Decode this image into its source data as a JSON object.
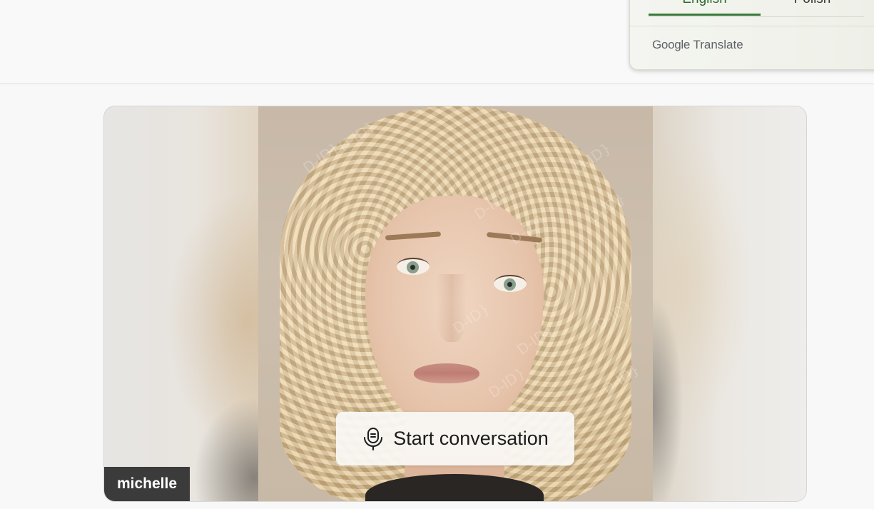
{
  "translate": {
    "tabs": [
      {
        "label": "English",
        "active": true
      },
      {
        "label": "Polish",
        "active": false
      }
    ],
    "brand_google": "Google",
    "brand_product": "Translate",
    "accent_color": "#3c7a3c"
  },
  "avatar": {
    "name": "michelle",
    "watermark": "D-ID}",
    "start_button_label": "Start conversation",
    "start_button_icon": "microphone-icon"
  }
}
